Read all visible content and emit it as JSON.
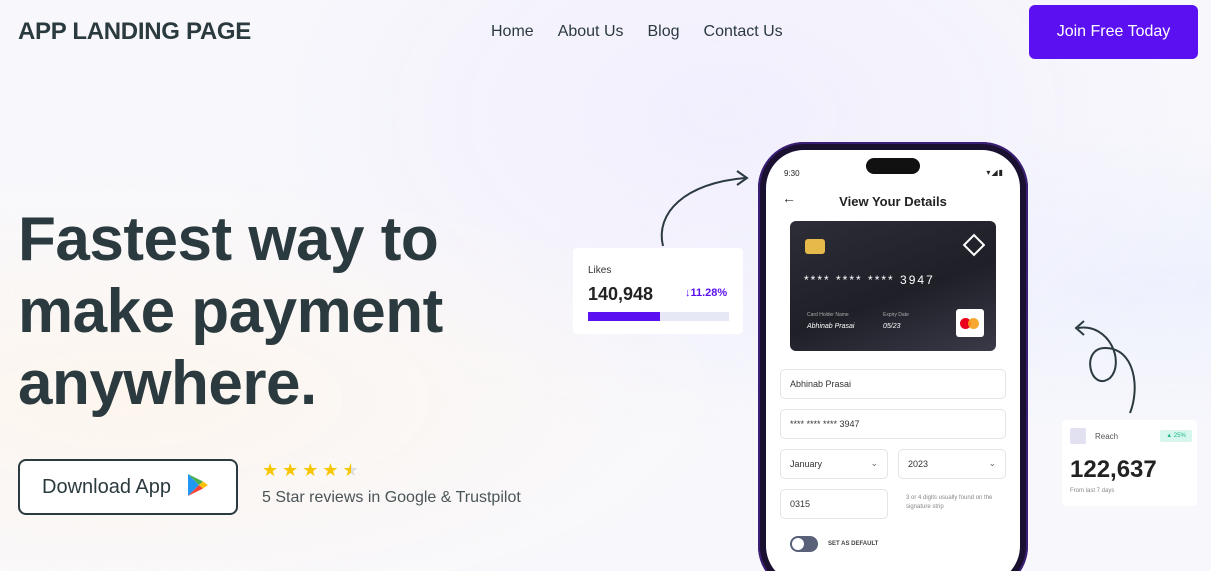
{
  "header": {
    "brand": "APP LANDING PAGE",
    "nav": [
      "Home",
      "About Us",
      "Blog",
      "Contact Us"
    ],
    "cta": "Join Free Today"
  },
  "hero": {
    "title_lines": [
      "Fastest way to",
      "make payment",
      "anywhere."
    ],
    "download_label": "Download App",
    "rating": 4.5,
    "reviews_text": "5 Star reviews in Google & Trustpilot"
  },
  "likes_card": {
    "title": "Likes",
    "value": "140,948",
    "delta": "↓11.28%",
    "progress": 0.51
  },
  "reach_card": {
    "title": "Reach",
    "badge": "▲ 25%",
    "value": "122,637",
    "subtitle": "From last 7 days"
  },
  "phone": {
    "time": "9:30",
    "title": "View Your Details",
    "card": {
      "number": "**** **** **** 3947",
      "holder_label": "Card Holder Name",
      "holder_name": "Abhinab Prasai",
      "expiry_label": "Expiry Date",
      "expiry": "05/23"
    },
    "fields": {
      "name": "Abhinab Prasai",
      "card_number": "**** **** **** 3947",
      "month": "January",
      "year": "2023",
      "cvv": "0315",
      "cvv_hint": "3 or 4 digits usually found on the signature strip"
    },
    "toggle_label": "SET AS DEFAULT"
  },
  "colors": {
    "accent": "#5b10f1",
    "text": "#2b3a3f",
    "star": "#f7c600"
  }
}
